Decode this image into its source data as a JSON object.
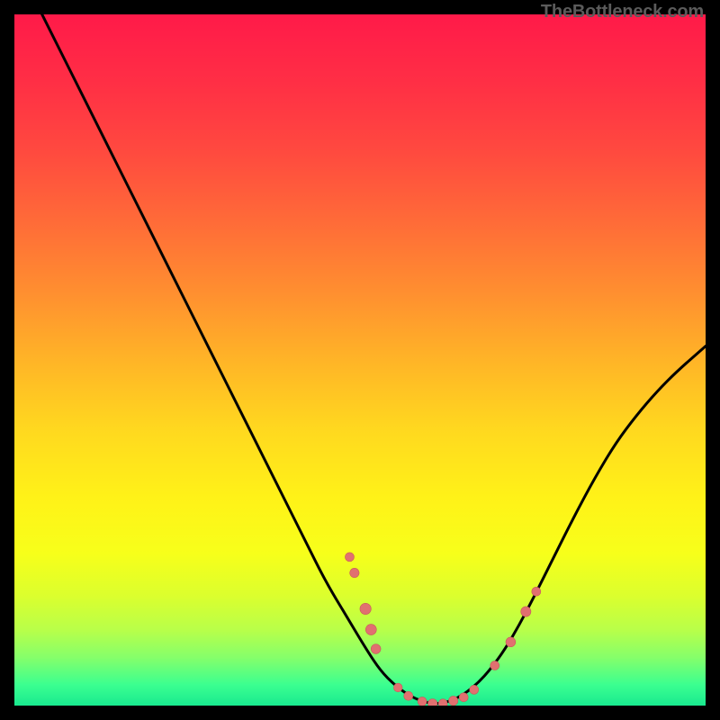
{
  "watermark": "TheBottleneck.com",
  "colors": {
    "gradient_stops": [
      {
        "offset": 0.0,
        "color": "#ff1a49"
      },
      {
        "offset": 0.1,
        "color": "#ff2f45"
      },
      {
        "offset": 0.2,
        "color": "#ff4a3f"
      },
      {
        "offset": 0.3,
        "color": "#ff6b38"
      },
      {
        "offset": 0.4,
        "color": "#ff8e30"
      },
      {
        "offset": 0.5,
        "color": "#ffb427"
      },
      {
        "offset": 0.6,
        "color": "#ffd81f"
      },
      {
        "offset": 0.7,
        "color": "#fff218"
      },
      {
        "offset": 0.78,
        "color": "#f7ff1a"
      },
      {
        "offset": 0.84,
        "color": "#dcff2d"
      },
      {
        "offset": 0.89,
        "color": "#b9ff49"
      },
      {
        "offset": 0.93,
        "color": "#86ff6a"
      },
      {
        "offset": 0.97,
        "color": "#3bff90"
      },
      {
        "offset": 1.0,
        "color": "#19e98f"
      }
    ],
    "curve": "#000000",
    "dot_fill": "#e17070",
    "dot_stroke": "#c85a5a"
  },
  "chart_data": {
    "type": "line",
    "title": "",
    "xlabel": "",
    "ylabel": "",
    "xlim": [
      0,
      100
    ],
    "ylim": [
      0,
      100
    ],
    "series": [
      {
        "name": "bottleneck-curve",
        "x": [
          0,
          3,
          6,
          9,
          12,
          15,
          18,
          21,
          24,
          27,
          30,
          33,
          36,
          39,
          42,
          45,
          48,
          51,
          53,
          55,
          57,
          59,
          61,
          63,
          65,
          67,
          69,
          71,
          73,
          75,
          78,
          81,
          84,
          87,
          90,
          93,
          96,
          100
        ],
        "y": [
          108,
          102,
          96,
          90,
          84,
          78,
          72,
          66,
          60,
          54,
          48,
          42,
          36,
          30,
          24,
          18,
          13,
          8,
          5,
          3,
          1.5,
          0.6,
          0.2,
          0.6,
          1.6,
          3.2,
          5.4,
          8.2,
          11.6,
          15.4,
          21.4,
          27.4,
          33,
          38,
          42,
          45.5,
          48.5,
          52
        ]
      }
    ],
    "dots": {
      "name": "sample-points",
      "points": [
        {
          "x": 48.5,
          "y": 21.5,
          "r": 5
        },
        {
          "x": 49.2,
          "y": 19.2,
          "r": 5.2
        },
        {
          "x": 50.8,
          "y": 14.0,
          "r": 6.2
        },
        {
          "x": 51.6,
          "y": 11.0,
          "r": 6.0
        },
        {
          "x": 52.3,
          "y": 8.2,
          "r": 5.4
        },
        {
          "x": 55.5,
          "y": 2.6,
          "r": 4.8
        },
        {
          "x": 57.0,
          "y": 1.4,
          "r": 5.0
        },
        {
          "x": 59.0,
          "y": 0.6,
          "r": 5.0
        },
        {
          "x": 60.5,
          "y": 0.3,
          "r": 5.2
        },
        {
          "x": 62.0,
          "y": 0.3,
          "r": 5.0
        },
        {
          "x": 63.5,
          "y": 0.7,
          "r": 5.2
        },
        {
          "x": 65.0,
          "y": 1.2,
          "r": 5.0
        },
        {
          "x": 66.5,
          "y": 2.3,
          "r": 5.0
        },
        {
          "x": 69.5,
          "y": 5.8,
          "r": 5.0
        },
        {
          "x": 71.8,
          "y": 9.2,
          "r": 5.4
        },
        {
          "x": 74.0,
          "y": 13.6,
          "r": 5.6
        },
        {
          "x": 75.5,
          "y": 16.5,
          "r": 5.0
        }
      ]
    }
  }
}
